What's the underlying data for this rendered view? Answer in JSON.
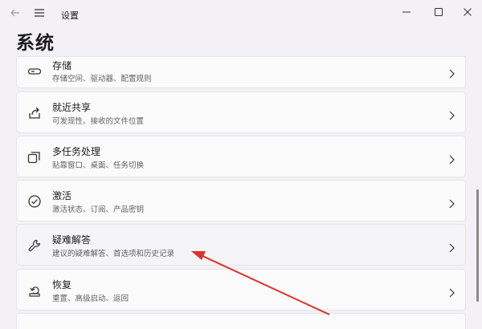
{
  "window": {
    "title": "设置",
    "back_icon": "back-arrow-icon",
    "menu_icon": "hamburger-menu-icon",
    "controls": [
      "minimize-icon",
      "maximize-icon",
      "close-icon"
    ]
  },
  "page": {
    "title": "系统"
  },
  "settings_items": [
    {
      "title": "存储",
      "subtitle": "存储空间、驱动器、配置规则",
      "icon": "storage-icon"
    },
    {
      "title": "就近共享",
      "subtitle": "可发现性、接收的文件位置",
      "icon": "nearby-share-icon"
    },
    {
      "title": "多任务处理",
      "subtitle": "贴靠窗口、桌面、任务切换",
      "icon": "multitasking-icon"
    },
    {
      "title": "激活",
      "subtitle": "激活状态、订阅、产品密钥",
      "icon": "activation-icon"
    },
    {
      "title": "疑难解答",
      "subtitle": "建议的疑难解答、首选项和历史记录",
      "icon": "troubleshoot-wrench-icon"
    },
    {
      "title": "恢复",
      "subtitle": "重置、高级启动、返回",
      "icon": "recovery-icon"
    }
  ],
  "annotation": {
    "color": "#e0302a",
    "points_to": "疑难解答"
  }
}
